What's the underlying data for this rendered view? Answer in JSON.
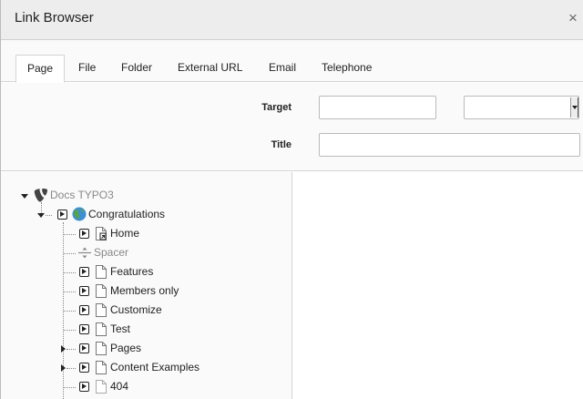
{
  "window": {
    "title": "Link Browser",
    "close_glyph": "×"
  },
  "tabs": [
    {
      "label": "Page",
      "active": true
    },
    {
      "label": "File",
      "active": false
    },
    {
      "label": "Folder",
      "active": false
    },
    {
      "label": "External URL",
      "active": false
    },
    {
      "label": "Email",
      "active": false
    },
    {
      "label": "Telephone",
      "active": false
    }
  ],
  "form": {
    "target_label": "Target",
    "target_value": "",
    "target_select_value": "",
    "title_label": "Title",
    "title_value": ""
  },
  "tree": {
    "root": {
      "label": "Docs TYPO3",
      "icon": "typo3-logo-icon",
      "expanded": true
    },
    "site": {
      "label": "Congratulations",
      "icon": "globe-icon",
      "expanded": true
    },
    "items": [
      {
        "label": "Home",
        "icon": "shortcut-page-icon",
        "has_children": false
      },
      {
        "label": "Spacer",
        "icon": "spacer-icon",
        "has_children": false,
        "muted": true
      },
      {
        "label": "Features",
        "icon": "page-icon",
        "has_children": false
      },
      {
        "label": "Members only",
        "icon": "page-icon",
        "has_children": false
      },
      {
        "label": "Customize",
        "icon": "page-icon",
        "has_children": false
      },
      {
        "label": "Test",
        "icon": "page-icon",
        "has_children": false
      },
      {
        "label": "Pages",
        "icon": "page-icon",
        "has_children": true
      },
      {
        "label": "Content Examples",
        "icon": "page-icon",
        "has_children": true
      },
      {
        "label": "404",
        "icon": "page-icon-muted",
        "has_children": false
      }
    ]
  },
  "colors": {
    "header_bg": "#ededed",
    "panel_bg": "#fafafa",
    "border": "#d4d4d4",
    "globe_blue": "#3b8fd9",
    "globe_green": "#5aa832"
  }
}
